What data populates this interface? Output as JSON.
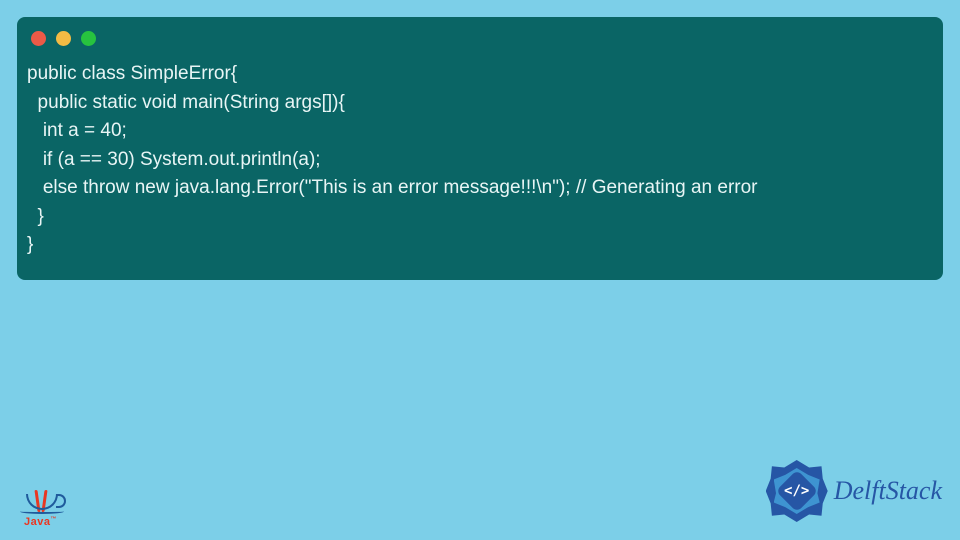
{
  "code": {
    "line1": "public class SimpleError{",
    "line2": "  public static void main(String args[]){",
    "line3": "   int a = 40;",
    "line4": "   if (a == 30) System.out.println(a);",
    "line5": "   else throw new java.lang.Error(\"This is an error message!!!\\n\"); // Generating an error",
    "line6": "  }",
    "line7": "}"
  },
  "logos": {
    "java_text": "Java",
    "java_tm": "™",
    "delft_text": "DelftStack",
    "delft_code": "</>"
  }
}
